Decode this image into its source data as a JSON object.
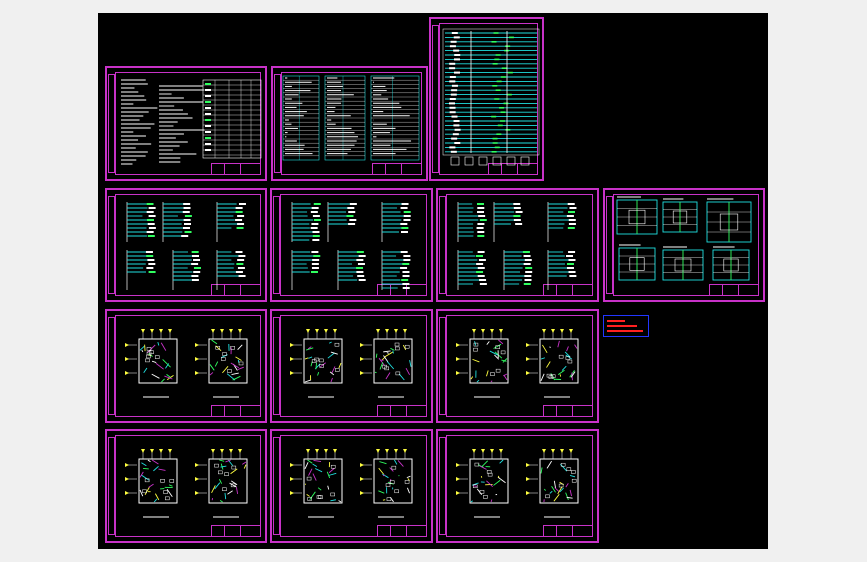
{
  "window": {
    "title": "",
    "background": "#f0f0f0"
  },
  "canvas": {
    "background": "#000000"
  },
  "colors": {
    "frame": "#c832c8",
    "cyan": "#20e0e0",
    "green": "#30ff60",
    "yellow": "#ffff40",
    "white": "#ffffff",
    "blue": "#2236ff",
    "red": "#ff2020"
  },
  "sheets": [
    {
      "id": "s01",
      "kind": "notes"
    },
    {
      "id": "s02",
      "kind": "table"
    },
    {
      "id": "s03",
      "kind": "riser"
    },
    {
      "id": "s04",
      "kind": "schematic"
    },
    {
      "id": "s05",
      "kind": "schematic"
    },
    {
      "id": "s06",
      "kind": "schematic"
    },
    {
      "id": "s07",
      "kind": "details"
    },
    {
      "id": "s08",
      "kind": "plan"
    },
    {
      "id": "s09",
      "kind": "plan"
    },
    {
      "id": "s10",
      "kind": "plan"
    },
    {
      "id": "s11",
      "kind": "plan"
    },
    {
      "id": "s12",
      "kind": "plan"
    },
    {
      "id": "s13",
      "kind": "plan"
    }
  ],
  "legend": {
    "kind": "red-note-block"
  }
}
